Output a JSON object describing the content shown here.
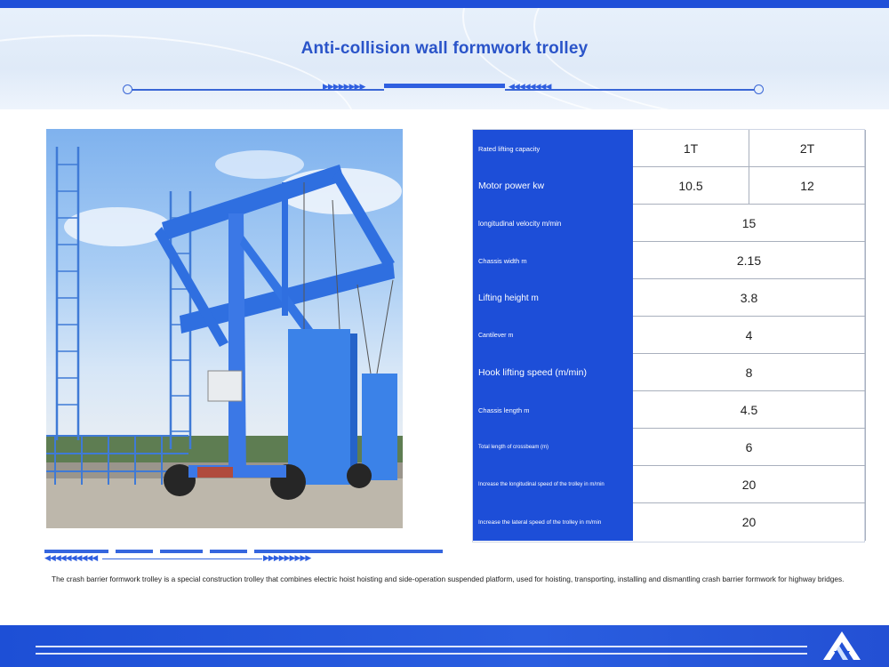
{
  "header": {
    "title": "Anti-collision wall formwork trolley"
  },
  "photo": {
    "subject": "blue gantry formwork trolley"
  },
  "specs": {
    "rows": [
      {
        "label": "Rated lifting capacity",
        "values": [
          "1T",
          "2T"
        ],
        "size": 7.5
      },
      {
        "label": "Motor power kw",
        "values": [
          "10.5",
          "12"
        ],
        "size": 10.5
      },
      {
        "label": "longitudinal velocity m/min",
        "values": [
          "15"
        ],
        "size": 8
      },
      {
        "label": "Chassis width m",
        "values": [
          "2.15"
        ],
        "size": 7.5
      },
      {
        "label": "Lifting height m",
        "values": [
          "3.8"
        ],
        "size": 10
      },
      {
        "label": "Cantilever m",
        "values": [
          "4"
        ],
        "size": 7
      },
      {
        "label": "Hook lifting speed (m/min)",
        "values": [
          "8"
        ],
        "size": 10.5
      },
      {
        "label": "Chassis length m",
        "values": [
          "4.5"
        ],
        "size": 7.5
      },
      {
        "label": "Total length of crossbeam (m)",
        "values": [
          "6"
        ],
        "size": 6
      },
      {
        "label": "Increase the longitudinal speed of the trolley in m/min",
        "values": [
          "20"
        ],
        "size": 6
      },
      {
        "label": "Increase the lateral speed of the trolley in m/min",
        "values": [
          "20"
        ],
        "size": 6.5
      }
    ]
  },
  "caption": "The crash barrier formwork trolley is a special construction trolley that combines electric hoist hoisting and side-operation suspended platform, used for hoisting, transporting, installing and dismantling crash barrier formwork for highway bridges.",
  "colors": {
    "brand_blue": "#1d4ed8",
    "title_blue": "#2a54c9"
  },
  "icons": {
    "logo": "company-logo-icon"
  }
}
